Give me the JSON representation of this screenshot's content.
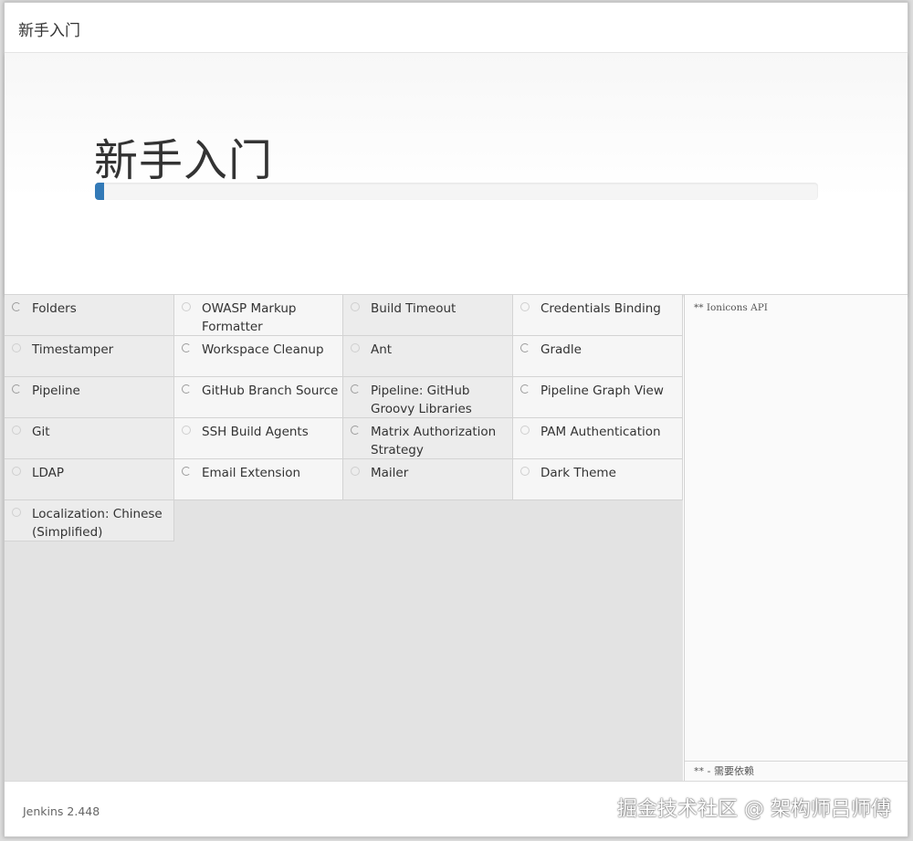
{
  "window": {
    "title": "新手入门"
  },
  "hero": {
    "heading": "新手入门",
    "progress_fraction": 0.012
  },
  "plugins": [
    {
      "name": "Folders",
      "status": "installing"
    },
    {
      "name": "OWASP Markup Formatter",
      "status": "pending"
    },
    {
      "name": "Build Timeout",
      "status": "pending"
    },
    {
      "name": "Credentials Binding",
      "status": "pending"
    },
    {
      "name": "Timestamper",
      "status": "pending"
    },
    {
      "name": "Workspace Cleanup",
      "status": "installing"
    },
    {
      "name": "Ant",
      "status": "pending"
    },
    {
      "name": "Gradle",
      "status": "installing"
    },
    {
      "name": "Pipeline",
      "status": "installing"
    },
    {
      "name": "GitHub Branch Source",
      "status": "installing"
    },
    {
      "name": "Pipeline: GitHub Groovy Libraries",
      "status": "installing"
    },
    {
      "name": "Pipeline Graph View",
      "status": "installing"
    },
    {
      "name": "Git",
      "status": "pending"
    },
    {
      "name": "SSH Build Agents",
      "status": "pending"
    },
    {
      "name": "Matrix Authorization Strategy",
      "status": "installing"
    },
    {
      "name": "PAM Authentication",
      "status": "pending"
    },
    {
      "name": "LDAP",
      "status": "pending"
    },
    {
      "name": "Email Extension",
      "status": "installing"
    },
    {
      "name": "Mailer",
      "status": "pending"
    },
    {
      "name": "Dark Theme",
      "status": "pending"
    },
    {
      "name": "Localization: Chinese (Simplified)",
      "status": "pending"
    }
  ],
  "log": {
    "text": "** Ionicons API",
    "legend": "** - 需要依赖"
  },
  "footer": {
    "version": "Jenkins 2.448",
    "watermark": "掘金技术社区 @ 架构师吕师傅"
  },
  "colors": {
    "progress_accent": "#337ab7"
  }
}
